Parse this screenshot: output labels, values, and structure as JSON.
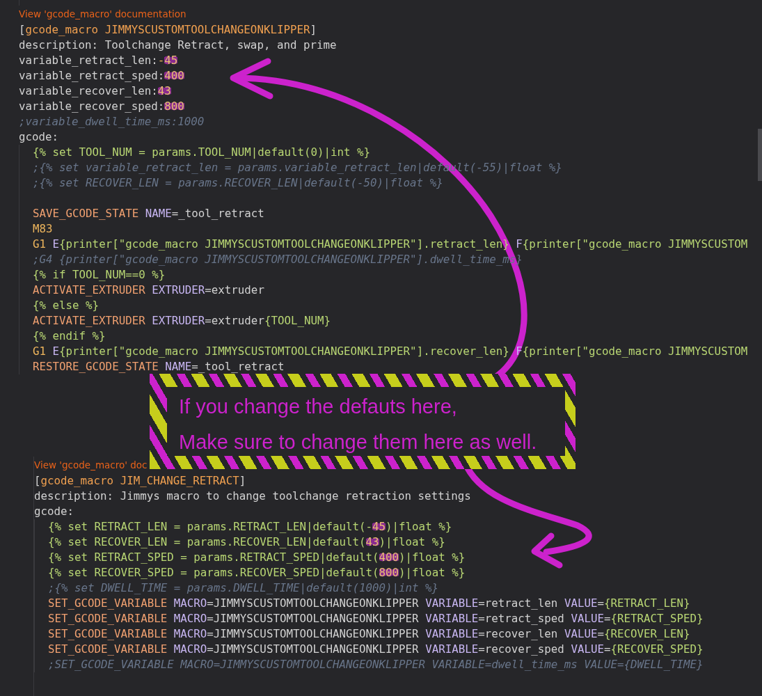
{
  "blocks": [
    {
      "doc_link": "View 'gcode_macro' documentation",
      "lines": [
        {
          "tokens": [
            {
              "kind": "plain",
              "text": "["
            },
            {
              "kind": "section",
              "text": "gcode_macro JIMMYSCUSTOMTOOLCHANGEONKLIPPER"
            },
            {
              "kind": "plain",
              "text": "]"
            }
          ]
        },
        {
          "tokens": [
            {
              "kind": "plain",
              "text": "description: Toolchange Retract, swap, and prime"
            }
          ]
        },
        {
          "tokens": [
            {
              "kind": "plain",
              "text": "variable_retract_len:"
            },
            {
              "kind": "number",
              "text": "-"
            },
            {
              "kind": "highlight",
              "text": "45"
            }
          ]
        },
        {
          "tokens": [
            {
              "kind": "plain",
              "text": "variable_retract_sped:"
            },
            {
              "kind": "highlight",
              "text": "400"
            }
          ]
        },
        {
          "tokens": [
            {
              "kind": "plain",
              "text": "variable_recover_len:"
            },
            {
              "kind": "highlight",
              "text": "43"
            }
          ]
        },
        {
          "tokens": [
            {
              "kind": "plain",
              "text": "variable_recover_sped:"
            },
            {
              "kind": "highlight",
              "text": "800"
            }
          ]
        },
        {
          "tokens": [
            {
              "kind": "comment",
              "text": ";variable_dwell_time_ms:1000"
            }
          ]
        },
        {
          "tokens": [
            {
              "kind": "plain",
              "text": "gcode:"
            }
          ],
          "children": [
            {
              "tokens": [
                {
                  "kind": "jinja",
                  "text": "{% set TOOL_NUM = params.TOOL_NUM|default(0)|int %}"
                }
              ]
            },
            {
              "tokens": [
                {
                  "kind": "comment",
                  "text": ";{% set variable_retract_len = params.variable_retract_len|default(-55)|float %}"
                }
              ]
            },
            {
              "tokens": [
                {
                  "kind": "comment",
                  "text": ";{% set RECOVER_LEN = params.RECOVER_LEN|default(-50)|float %}"
                }
              ]
            },
            {
              "kind": "blank"
            },
            {
              "tokens": [
                {
                  "kind": "command",
                  "text": "SAVE_GCODE_STATE"
                },
                {
                  "kind": "param",
                  "text": " NAME"
                },
                {
                  "kind": "plain",
                  "text": "=_tool_retract"
                }
              ]
            },
            {
              "tokens": [
                {
                  "kind": "number",
                  "text": "M83"
                }
              ]
            },
            {
              "tokens": [
                {
                  "kind": "number",
                  "text": "G1"
                },
                {
                  "kind": "param",
                  "text": " E"
                },
                {
                  "kind": "jinja",
                  "text": "{printer[\"gcode_macro JIMMYSCUSTOMTOOLCHANGEONKLIPPER\"].retract_len}"
                },
                {
                  "kind": "param",
                  "text": " F"
                },
                {
                  "kind": "jinja",
                  "text": "{printer[\"gcode_macro JIMMYSCUSTOM"
                }
              ]
            },
            {
              "tokens": [
                {
                  "kind": "comment",
                  "text": ";G4 {printer[\"gcode_macro JIMMYSCUSTOMTOOLCHANGEONKLIPPER\"].dwell_time_ms}"
                }
              ]
            },
            {
              "tokens": [
                {
                  "kind": "jinja",
                  "text": "{% if TOOL_NUM==0 %}"
                }
              ]
            },
            {
              "tokens": [
                {
                  "kind": "command",
                  "text": "ACTIVATE_EXTRUDER"
                },
                {
                  "kind": "param",
                  "text": " EXTRUDER"
                },
                {
                  "kind": "plain",
                  "text": "=extruder"
                }
              ]
            },
            {
              "tokens": [
                {
                  "kind": "jinja",
                  "text": "{% else %}"
                }
              ]
            },
            {
              "tokens": [
                {
                  "kind": "command",
                  "text": "ACTIVATE_EXTRUDER"
                },
                {
                  "kind": "param",
                  "text": " EXTRUDER"
                },
                {
                  "kind": "plain",
                  "text": "=extruder"
                },
                {
                  "kind": "jinja",
                  "text": "{TOOL_NUM}"
                }
              ]
            },
            {
              "tokens": [
                {
                  "kind": "jinja",
                  "text": "{% endif %}"
                }
              ]
            },
            {
              "tokens": [
                {
                  "kind": "number",
                  "text": "G1"
                },
                {
                  "kind": "param",
                  "text": " E"
                },
                {
                  "kind": "jinja",
                  "text": "{printer[\"gcode_macro JIMMYSCUSTOMTOOLCHANGEONKLIPPER\"].recover_len}"
                },
                {
                  "kind": "param",
                  "text": " F"
                },
                {
                  "kind": "jinja",
                  "text": "{printer[\"gcode_macro JIMMYSCUSTOM"
                }
              ]
            },
            {
              "tokens": [
                {
                  "kind": "command",
                  "text": "RESTORE_GCODE_STATE"
                },
                {
                  "kind": "param",
                  "text": " NAME"
                },
                {
                  "kind": "plain",
                  "text": "=_tool_retract"
                }
              ]
            }
          ]
        }
      ]
    },
    {
      "doc_link": "View 'gcode_macro' doc",
      "lines": [
        {
          "tokens": [
            {
              "kind": "plain",
              "text": "["
            },
            {
              "kind": "section",
              "text": "gcode_macro JIM_CHANGE_RETRACT"
            },
            {
              "kind": "plain",
              "text": "]"
            }
          ]
        },
        {
          "tokens": [
            {
              "kind": "plain",
              "text": "description: Jimmys macro to change toolchange retraction settings"
            }
          ]
        },
        {
          "tokens": [
            {
              "kind": "plain",
              "text": "gcode:"
            }
          ],
          "children": [
            {
              "tokens": [
                {
                  "kind": "jinja",
                  "text": "{% set RETRACT_LEN = params.RETRACT_LEN|default(-"
                },
                {
                  "kind": "highlight",
                  "text": "45"
                },
                {
                  "kind": "jinja",
                  "text": ")|float %}"
                }
              ]
            },
            {
              "tokens": [
                {
                  "kind": "jinja",
                  "text": "{% set RECOVER_LEN = params.RECOVER_LEN|default("
                },
                {
                  "kind": "highlight",
                  "text": "43"
                },
                {
                  "kind": "jinja",
                  "text": ")|float %}"
                }
              ]
            },
            {
              "tokens": [
                {
                  "kind": "jinja",
                  "text": "{% set RETRACT_SPED = params.RETRACT_SPED|default("
                },
                {
                  "kind": "highlight",
                  "text": "400"
                },
                {
                  "kind": "jinja",
                  "text": ")|float %}"
                }
              ]
            },
            {
              "tokens": [
                {
                  "kind": "jinja",
                  "text": "{% set RECOVER_SPED = params.RECOVER_SPED|default("
                },
                {
                  "kind": "highlight",
                  "text": "800"
                },
                {
                  "kind": "jinja",
                  "text": ")|float %}"
                }
              ]
            },
            {
              "tokens": [
                {
                  "kind": "comment",
                  "text": ";{% set DWELL_TIME = params.DWELL_TIME|default(1000)|int %}"
                }
              ]
            },
            {
              "tokens": [
                {
                  "kind": "command",
                  "text": "SET_GCODE_VARIABLE"
                },
                {
                  "kind": "param",
                  "text": " MACRO"
                },
                {
                  "kind": "plain",
                  "text": "=JIMMYSCUSTOMTOOLCHANGEONKLIPPER "
                },
                {
                  "kind": "param",
                  "text": "VARIABLE"
                },
                {
                  "kind": "plain",
                  "text": "=retract_len "
                },
                {
                  "kind": "param",
                  "text": "VALUE"
                },
                {
                  "kind": "plain",
                  "text": "="
                },
                {
                  "kind": "jinja",
                  "text": "{RETRACT_LEN}"
                }
              ]
            },
            {
              "tokens": [
                {
                  "kind": "command",
                  "text": "SET_GCODE_VARIABLE"
                },
                {
                  "kind": "param",
                  "text": " MACRO"
                },
                {
                  "kind": "plain",
                  "text": "=JIMMYSCUSTOMTOOLCHANGEONKLIPPER "
                },
                {
                  "kind": "param",
                  "text": "VARIABLE"
                },
                {
                  "kind": "plain",
                  "text": "=retract_sped "
                },
                {
                  "kind": "param",
                  "text": "VALUE"
                },
                {
                  "kind": "plain",
                  "text": "="
                },
                {
                  "kind": "jinja",
                  "text": "{RETRACT_SPED}"
                }
              ]
            },
            {
              "tokens": [
                {
                  "kind": "command",
                  "text": "SET_GCODE_VARIABLE"
                },
                {
                  "kind": "param",
                  "text": " MACRO"
                },
                {
                  "kind": "plain",
                  "text": "=JIMMYSCUSTOMTOOLCHANGEONKLIPPER "
                },
                {
                  "kind": "param",
                  "text": "VARIABLE"
                },
                {
                  "kind": "plain",
                  "text": "=recover_len "
                },
                {
                  "kind": "param",
                  "text": "VALUE"
                },
                {
                  "kind": "plain",
                  "text": "="
                },
                {
                  "kind": "jinja",
                  "text": "{RECOVER_LEN}"
                }
              ]
            },
            {
              "tokens": [
                {
                  "kind": "command",
                  "text": "SET_GCODE_VARIABLE"
                },
                {
                  "kind": "param",
                  "text": " MACRO"
                },
                {
                  "kind": "plain",
                  "text": "=JIMMYSCUSTOMTOOLCHANGEONKLIPPER "
                },
                {
                  "kind": "param",
                  "text": "VARIABLE"
                },
                {
                  "kind": "plain",
                  "text": "=recover_sped "
                },
                {
                  "kind": "param",
                  "text": "VALUE"
                },
                {
                  "kind": "plain",
                  "text": "="
                },
                {
                  "kind": "jinja",
                  "text": "{RECOVER_SPED}"
                }
              ]
            },
            {
              "tokens": [
                {
                  "kind": "comment",
                  "text": ";SET_GCODE_VARIABLE MACRO=JIMMYSCUSTOMTOOLCHANGEONKLIPPER VARIABLE=dwell_time_ms VALUE={DWELL_TIME}"
                }
              ]
            }
          ]
        }
      ]
    }
  ],
  "callout": {
    "lines": [
      "If you change the defauts here,",
      "Make sure to change them here as well."
    ]
  }
}
